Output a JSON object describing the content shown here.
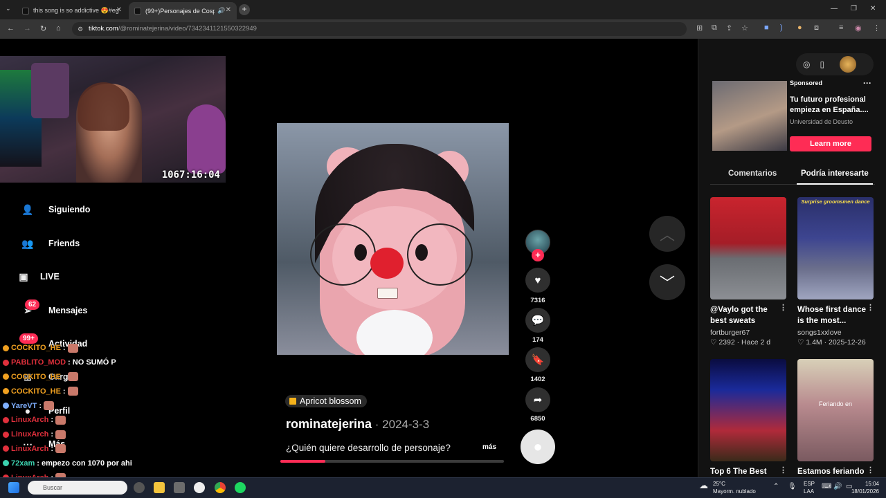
{
  "browser": {
    "tabs": [
      {
        "title": "this song is so addictive 😍#eg",
        "active": false
      },
      {
        "title": "(99+)Personajes de Cosplay",
        "active": true
      }
    ],
    "new_tab": "+",
    "url_host": "tiktok.com",
    "url_path": "/@rominatejerina/video/7342341121550322949"
  },
  "stream": {
    "timer": "1067:16:04"
  },
  "nav": {
    "items": [
      {
        "label": "Siguiendo",
        "icon": "following-icon"
      },
      {
        "label": "Friends",
        "icon": "friends-icon"
      },
      {
        "label": "LIVE",
        "icon": "live-icon"
      },
      {
        "label": "Mensajes",
        "icon": "messages-icon",
        "badge": "62"
      },
      {
        "label": "Actividad",
        "icon": "activity-icon",
        "badge": "99+"
      },
      {
        "label": "Cargar",
        "icon": "upload-icon"
      },
      {
        "label": "Perfil",
        "icon": "profile-icon"
      },
      {
        "label": "Más",
        "icon": "more-icon"
      }
    ]
  },
  "chat": {
    "lines": [
      {
        "user": "COCKITO_HE",
        "msg": ":",
        "color": "#f0a020"
      },
      {
        "user": "PABLITO_MOD",
        "msg": ": NO SUMÓ P",
        "color": "#e0303c"
      },
      {
        "user": "COCKITO_HE",
        "msg": ":",
        "color": "#f0a020"
      },
      {
        "user": "COCKITO_HE",
        "msg": ":",
        "color": "#f0a020"
      },
      {
        "user": "YareVT",
        "msg": ":",
        "color": "#7fb0ff"
      },
      {
        "user": "LinuxArch",
        "msg": ":",
        "color": "#e0303c"
      },
      {
        "user": "LinuxArch",
        "msg": ":",
        "color": "#e0303c"
      },
      {
        "user": "LinuxArch",
        "msg": ":",
        "color": "#e0303c"
      },
      {
        "user": "72xam",
        "msg": ": empezo con 1070 por ahi",
        "color": "#3cd3b0"
      },
      {
        "user": "LinuxArch",
        "msg": ":",
        "color": "#e0303c"
      },
      {
        "user": "LinuxArch",
        "msg": ":",
        "color": "#e0303c"
      }
    ]
  },
  "video": {
    "sound": "Apricot blossom",
    "author": "rominatejerina",
    "date": " · 2024-3-3",
    "description": "¿Quién quiere desarrollo de personaje?",
    "more": "más",
    "progress": 0.2
  },
  "actions": {
    "likes": "7316",
    "comments": "174",
    "saves": "1402",
    "shares": "6850"
  },
  "sponsored": {
    "tag": "Sponsored",
    "title": "Tu futuro profesional empieza en España....",
    "org": "Universidad de Deusto",
    "cta": "Learn more",
    "more": "···"
  },
  "right_tabs": {
    "comments": "Comentarios",
    "suggested": "Podría interesarte"
  },
  "suggested": [
    {
      "title": "@Vaylo got the best sweats",
      "author": "fortburger67",
      "meta": "♡ 2392 · Hace 2 d",
      "overlay": ""
    },
    {
      "title": "Whose first dance is the most...",
      "author": "songs1xxlove",
      "meta": "♡ 1.4M · 2025-12-26",
      "overlay": "Surprise groomsmen dance"
    },
    {
      "title": "Top 6 The Best",
      "author": "",
      "meta": "",
      "overlay": ""
    },
    {
      "title": "Estamos feriando",
      "author": "",
      "meta": "",
      "overlay": "Feriando en"
    }
  ],
  "taskbar": {
    "search": "Buscar",
    "weather_temp": "25°C",
    "weather_desc": "Mayorm. nublado",
    "lang1": "ESP",
    "lang2": "LAA",
    "time": "15:04",
    "date": "18/01/2026"
  }
}
